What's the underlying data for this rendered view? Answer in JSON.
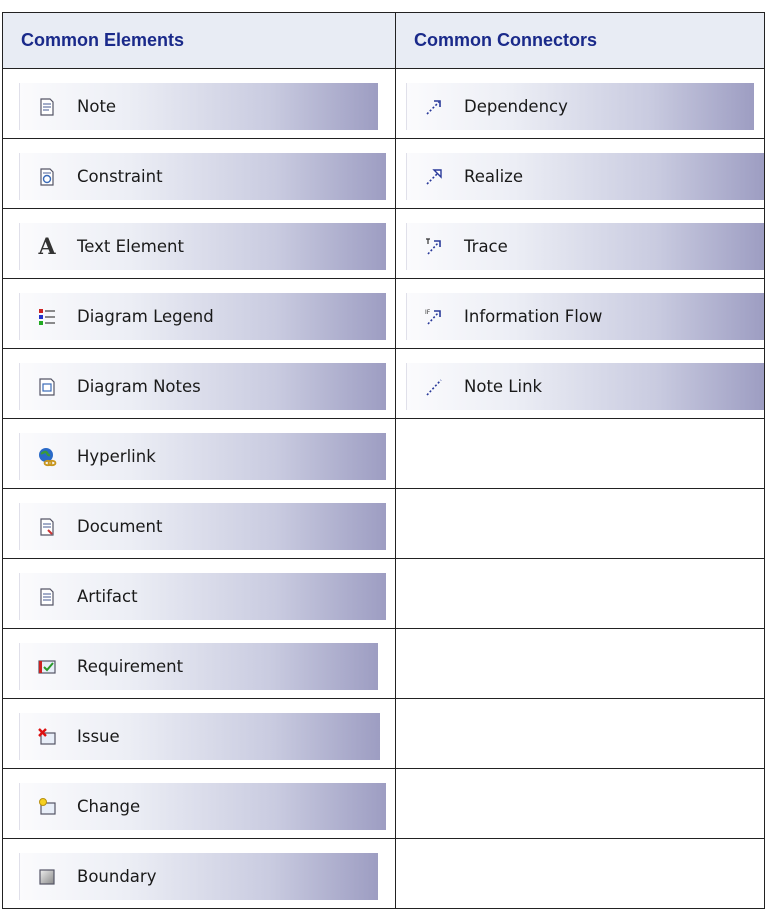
{
  "headers": {
    "elements": "Common Elements",
    "connectors": "Common Connectors"
  },
  "elements": [
    {
      "label": "Note",
      "icon": "note-icon"
    },
    {
      "label": "Constraint",
      "icon": "constraint-icon"
    },
    {
      "label": "Text Element",
      "icon": "text-element-icon"
    },
    {
      "label": "Diagram Legend",
      "icon": "diagram-legend-icon"
    },
    {
      "label": "Diagram Notes",
      "icon": "diagram-notes-icon"
    },
    {
      "label": "Hyperlink",
      "icon": "hyperlink-icon"
    },
    {
      "label": "Document",
      "icon": "document-icon"
    },
    {
      "label": "Artifact",
      "icon": "artifact-icon"
    },
    {
      "label": "Requirement",
      "icon": "requirement-icon"
    },
    {
      "label": "Issue",
      "icon": "issue-icon"
    },
    {
      "label": "Change",
      "icon": "change-icon"
    },
    {
      "label": "Boundary",
      "icon": "boundary-icon"
    }
  ],
  "connectors": [
    {
      "label": "Dependency",
      "icon": "dependency-icon"
    },
    {
      "label": "Realize",
      "icon": "realize-icon"
    },
    {
      "label": "Trace",
      "icon": "trace-icon"
    },
    {
      "label": "Information Flow",
      "icon": "information-flow-icon"
    },
    {
      "label": "Note Link",
      "icon": "note-link-icon"
    }
  ]
}
